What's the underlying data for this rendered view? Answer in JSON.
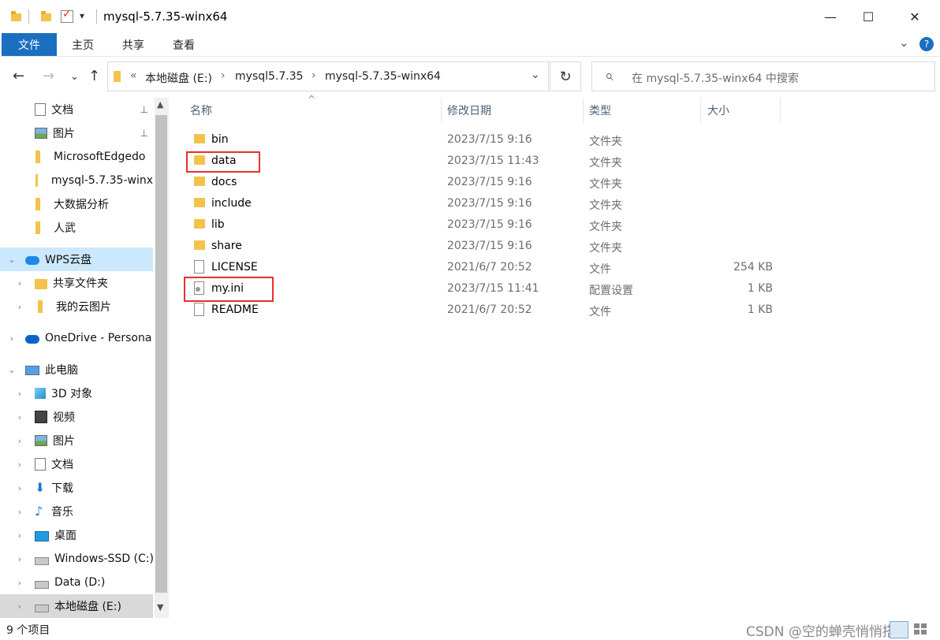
{
  "window": {
    "title": "mysql-5.7.35-winx64",
    "qat_dropdown": "▾",
    "minimize": "—",
    "maximize": "☐",
    "close": "✕"
  },
  "ribbon": {
    "tabs": [
      "文件",
      "主页",
      "共享",
      "查看"
    ],
    "expand": "⌄",
    "help": "?"
  },
  "nav": {
    "back": "←",
    "forward": "→",
    "recent": "⌄",
    "up": "↑"
  },
  "address": {
    "overflow": "«",
    "crumbs": [
      "本地磁盘 (E:)",
      "mysql5.7.35",
      "mysql-5.7.35-winx64"
    ],
    "separator": "›",
    "dropdown": "⌄",
    "refresh": "↻"
  },
  "search": {
    "placeholder": "在 mysql-5.7.35-winx64 中搜索",
    "icon": "⌕"
  },
  "navpane": {
    "items": [
      {
        "label": "文档"
      },
      {
        "label": "图片"
      },
      {
        "label": "MicrosoftEdgedo"
      },
      {
        "label": "mysql-5.7.35-winx"
      },
      {
        "label": "大数据分析"
      },
      {
        "label": "人武"
      },
      {
        "label": "WPS云盘"
      },
      {
        "label": "共享文件夹"
      },
      {
        "label": "我的云图片"
      },
      {
        "label": "OneDrive - Persona"
      },
      {
        "label": "此电脑"
      },
      {
        "label": "3D 对象"
      },
      {
        "label": "视频"
      },
      {
        "label": "图片"
      },
      {
        "label": "文档"
      },
      {
        "label": "下载"
      },
      {
        "label": "音乐"
      },
      {
        "label": "桌面"
      },
      {
        "label": "Windows-SSD (C:)"
      },
      {
        "label": "Data (D:)"
      },
      {
        "label": "本地磁盘 (E:)"
      }
    ],
    "pin": "📌",
    "chev_right": "›",
    "chev_down": "⌄"
  },
  "columns": {
    "name": "名称",
    "modified": "修改日期",
    "type": "类型",
    "size": "大小",
    "sort_indicator": "^"
  },
  "files": [
    {
      "name": "bin",
      "modified": "2023/7/15 9:16",
      "type": "文件夹",
      "size": ""
    },
    {
      "name": "data",
      "modified": "2023/7/15 11:43",
      "type": "文件夹",
      "size": ""
    },
    {
      "name": "docs",
      "modified": "2023/7/15 9:16",
      "type": "文件夹",
      "size": ""
    },
    {
      "name": "include",
      "modified": "2023/7/15 9:16",
      "type": "文件夹",
      "size": ""
    },
    {
      "name": "lib",
      "modified": "2023/7/15 9:16",
      "type": "文件夹",
      "size": ""
    },
    {
      "name": "share",
      "modified": "2023/7/15 9:16",
      "type": "文件夹",
      "size": ""
    },
    {
      "name": "LICENSE",
      "modified": "2021/6/7 20:52",
      "type": "文件",
      "size": "254 KB"
    },
    {
      "name": "my.ini",
      "modified": "2023/7/15 11:41",
      "type": "配置设置",
      "size": "1 KB"
    },
    {
      "name": "README",
      "modified": "2021/6/7 20:52",
      "type": "文件",
      "size": "1 KB"
    }
  ],
  "status": {
    "count": "9 个项目"
  },
  "watermark": "CSDN @空的蝉壳悄悄搭落"
}
